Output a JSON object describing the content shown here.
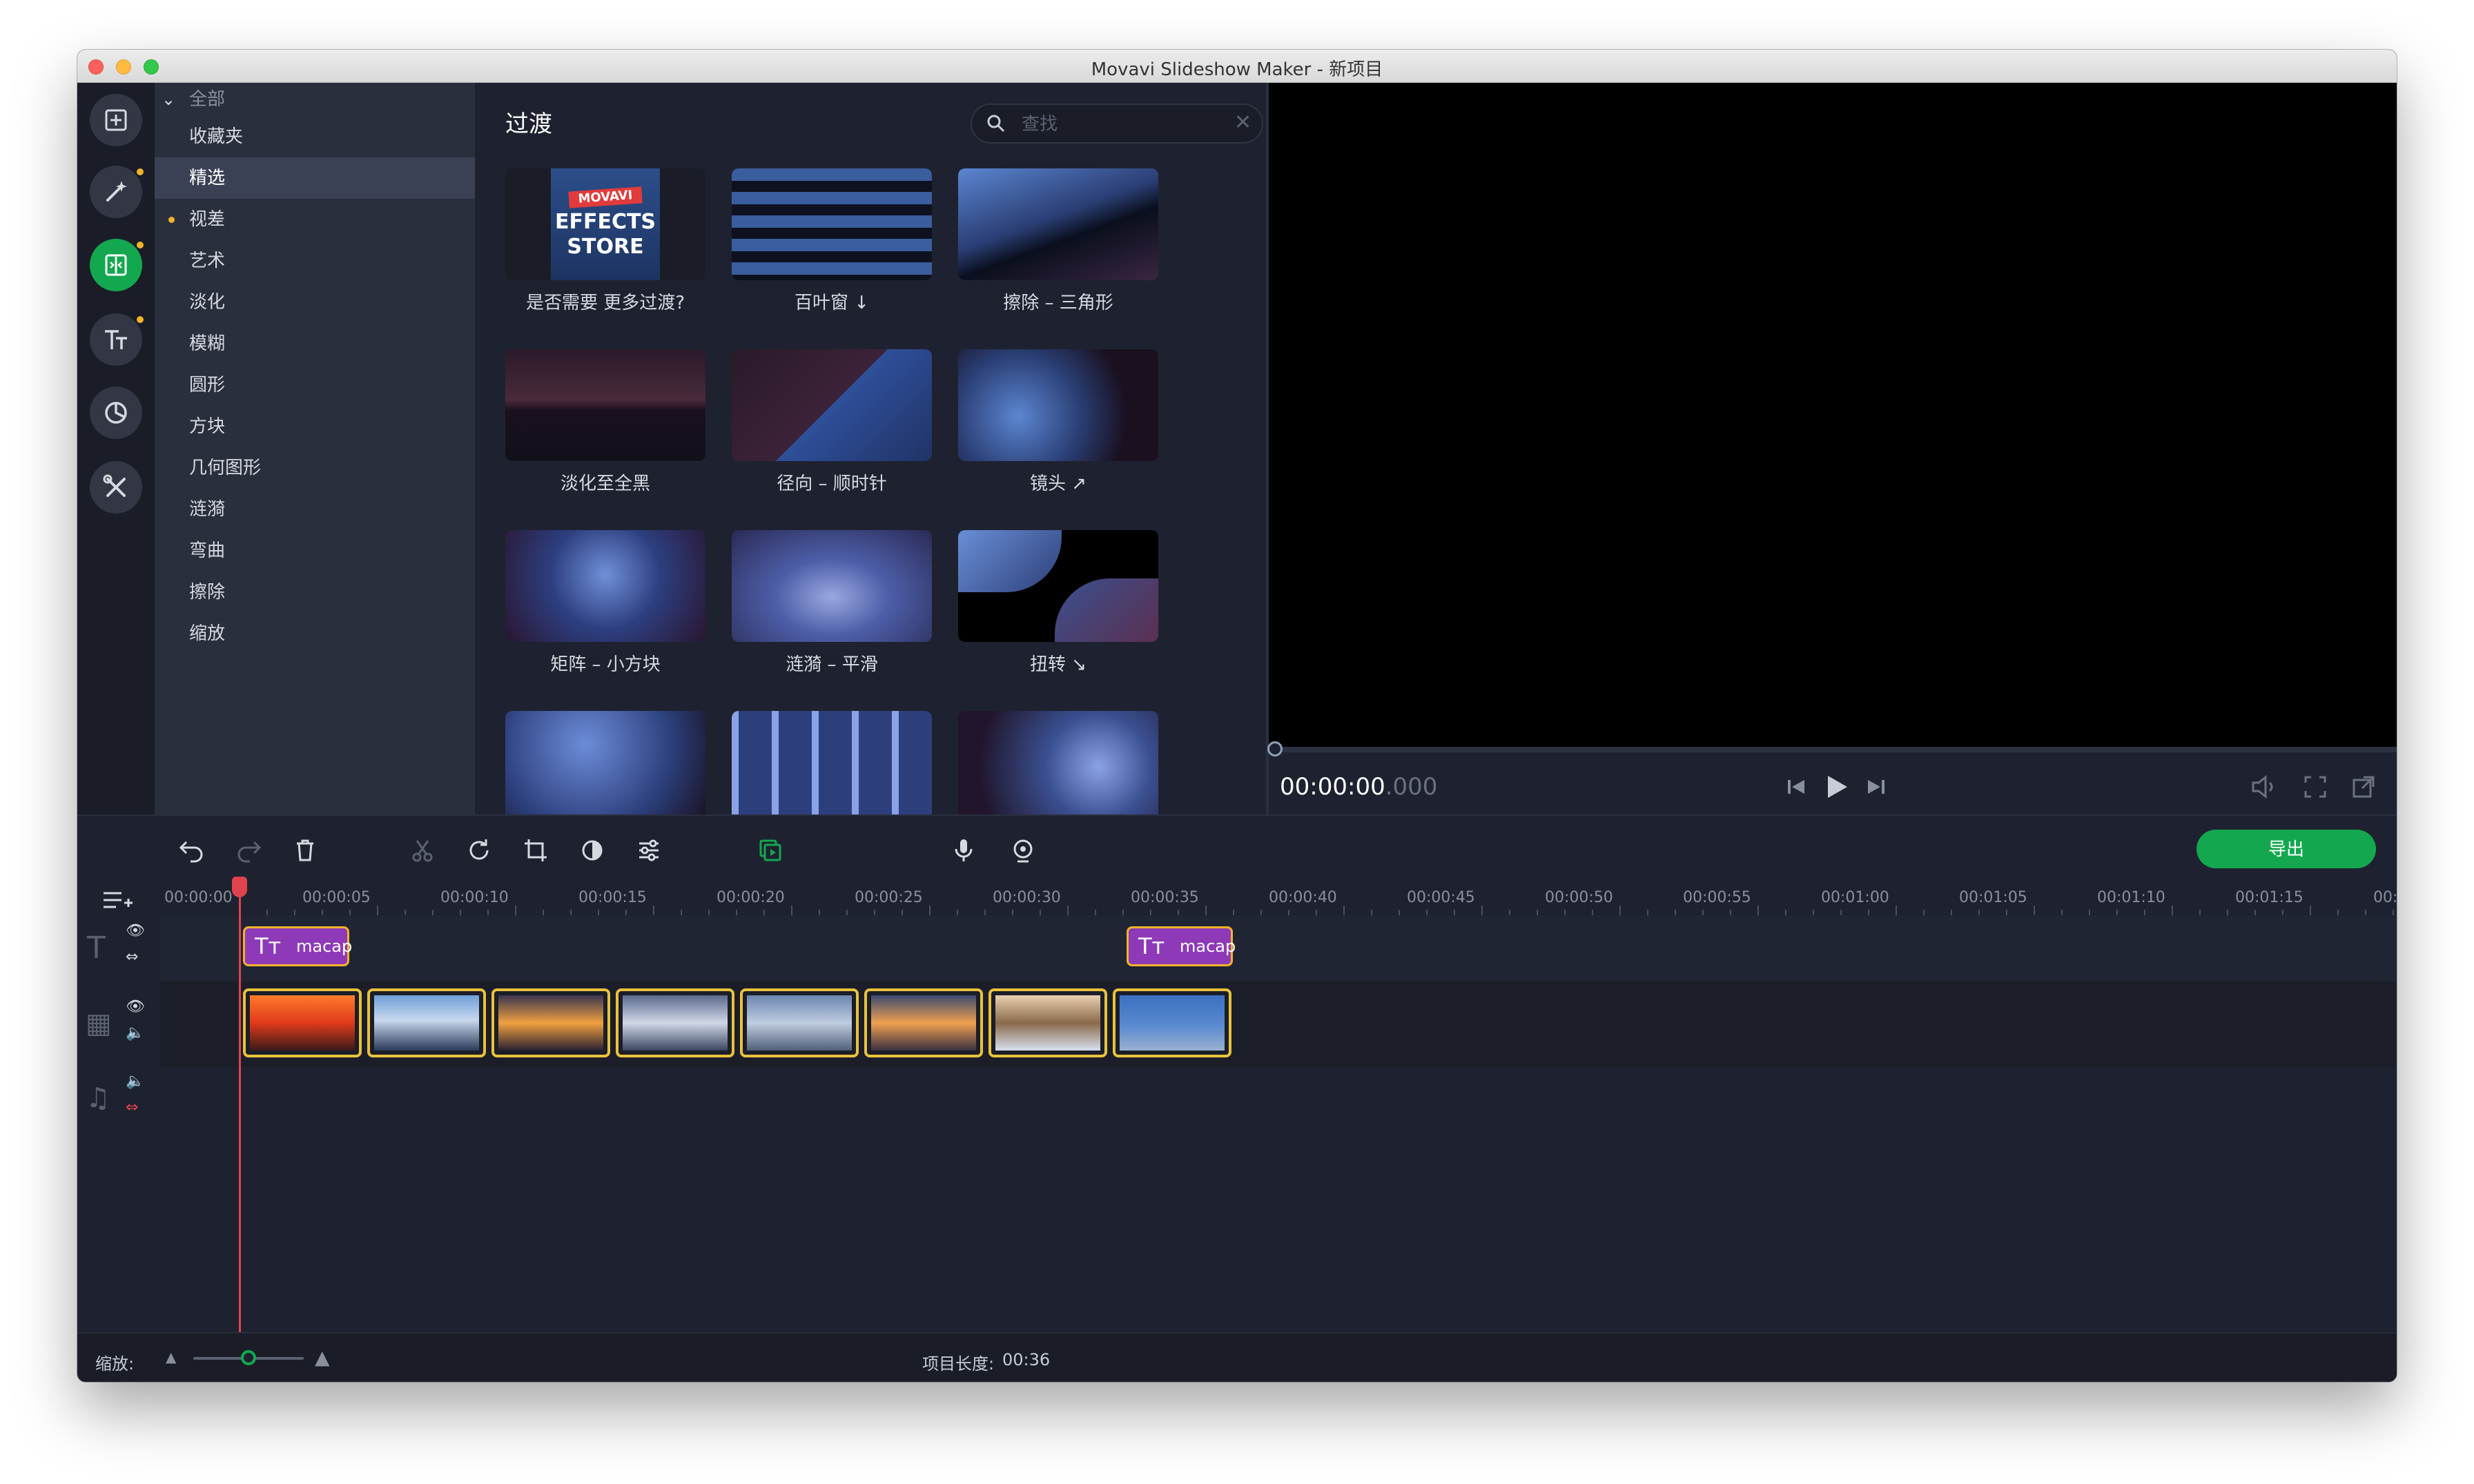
{
  "window": {
    "title": "Movavi Slideshow Maker - 新项目"
  },
  "categories": {
    "header": "全部",
    "items": [
      {
        "label": "收藏夹",
        "selected": false,
        "dot": false
      },
      {
        "label": "精选",
        "selected": true,
        "dot": false
      },
      {
        "label": "视差",
        "selected": false,
        "dot": true
      },
      {
        "label": "艺术",
        "selected": false,
        "dot": false
      },
      {
        "label": "淡化",
        "selected": false,
        "dot": false
      },
      {
        "label": "模糊",
        "selected": false,
        "dot": false
      },
      {
        "label": "圆形",
        "selected": false,
        "dot": false
      },
      {
        "label": "方块",
        "selected": false,
        "dot": false
      },
      {
        "label": "几何图形",
        "selected": false,
        "dot": false
      },
      {
        "label": "涟漪",
        "selected": false,
        "dot": false
      },
      {
        "label": "弯曲",
        "selected": false,
        "dot": false
      },
      {
        "label": "擦除",
        "selected": false,
        "dot": false
      },
      {
        "label": "缩放",
        "selected": false,
        "dot": false
      }
    ]
  },
  "gallery": {
    "title": "过渡",
    "search_placeholder": "查找",
    "store_thumb": {
      "brand": "MOVAVI",
      "line1": "EFFECTS",
      "line2": "STORE"
    },
    "items": [
      "是否需要 更多过渡?",
      "百叶窗 ↓",
      "擦除 – 三角形",
      "淡化至全黑",
      "径向 – 顺时针",
      "镜头 ↗",
      "矩阵 – 小方块",
      "涟漪 – 平滑",
      "扭转 ↘"
    ]
  },
  "player": {
    "time_main": "00:00:00",
    "time_ms": ".000"
  },
  "toolbar": {
    "export_label": "导出"
  },
  "timeline": {
    "ruler": [
      "00:00:00",
      "00:00:05",
      "00:00:10",
      "00:00:15",
      "00:00:20",
      "00:00:25",
      "00:00:30",
      "00:00:35",
      "00:00:40",
      "00:00:45",
      "00:00:50",
      "00:00:55",
      "00:01:00",
      "00:01:05",
      "00:01:10",
      "00:01:15",
      "00:"
    ],
    "title_clips": [
      "macap",
      "macap"
    ],
    "video_clip_count": 8
  },
  "status": {
    "zoom_label": "缩放:",
    "zoom_level": 0.5,
    "project_length_label": "项目长度:",
    "project_length": "00:36"
  },
  "colors": {
    "accent": "#13a84f",
    "title_clip": "#8e3ab8",
    "clip_border": "#e9c23c",
    "playhead": "#e0434e"
  }
}
